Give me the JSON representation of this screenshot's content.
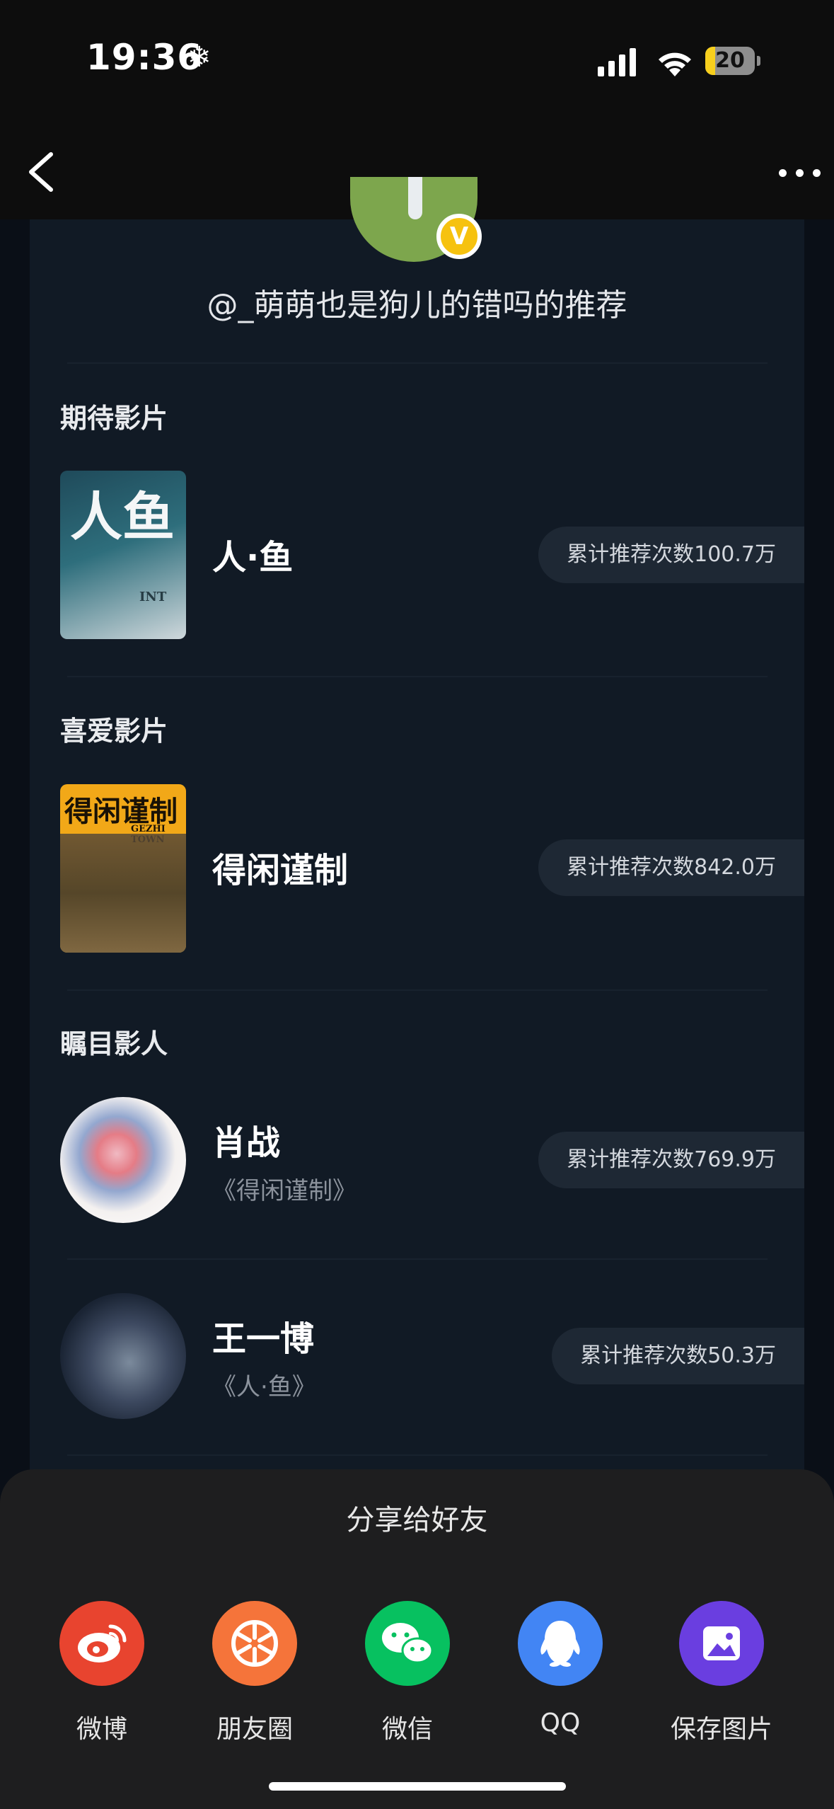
{
  "status": {
    "time": "19:36",
    "battery": "20",
    "battery_level": 0.2
  },
  "nav": {
    "back_icon": "chevron-left-icon",
    "more_icon": "more-dots-icon"
  },
  "header": {
    "title": "@_萌萌也是狗儿的错吗的推荐"
  },
  "sections": {
    "expected": {
      "title": "期待影片",
      "item": {
        "poster_text": "人鱼",
        "poster_sub": "INT",
        "name": "人·鱼",
        "count": "累计推荐次数100.7万"
      }
    },
    "favorite": {
      "title": "喜爱影片",
      "item": {
        "poster_text": "得闲谨制",
        "poster_sub": "GEZHI TOWN",
        "name": "得闲谨制",
        "count": "累计推荐次数842.0万"
      }
    },
    "people": {
      "title": "瞩目影人",
      "items": [
        {
          "name": "肖战",
          "work": "《得闲谨制》",
          "count": "累计推荐次数769.9万"
        },
        {
          "name": "王一博",
          "work": "《人·鱼》",
          "count": "累计推荐次数50.3万"
        }
      ]
    }
  },
  "share": {
    "title": "分享给好友",
    "items": [
      {
        "label": "微博",
        "icon": "weibo-icon",
        "color": "#e8442f"
      },
      {
        "label": "朋友圈",
        "icon": "moments-icon",
        "color": "#f5743a"
      },
      {
        "label": "微信",
        "icon": "wechat-icon",
        "color": "#07c160"
      },
      {
        "label": "QQ",
        "icon": "qq-icon",
        "color": "#4285f4"
      },
      {
        "label": "保存图片",
        "icon": "save-image-icon",
        "color": "#6a3ee0"
      }
    ]
  }
}
